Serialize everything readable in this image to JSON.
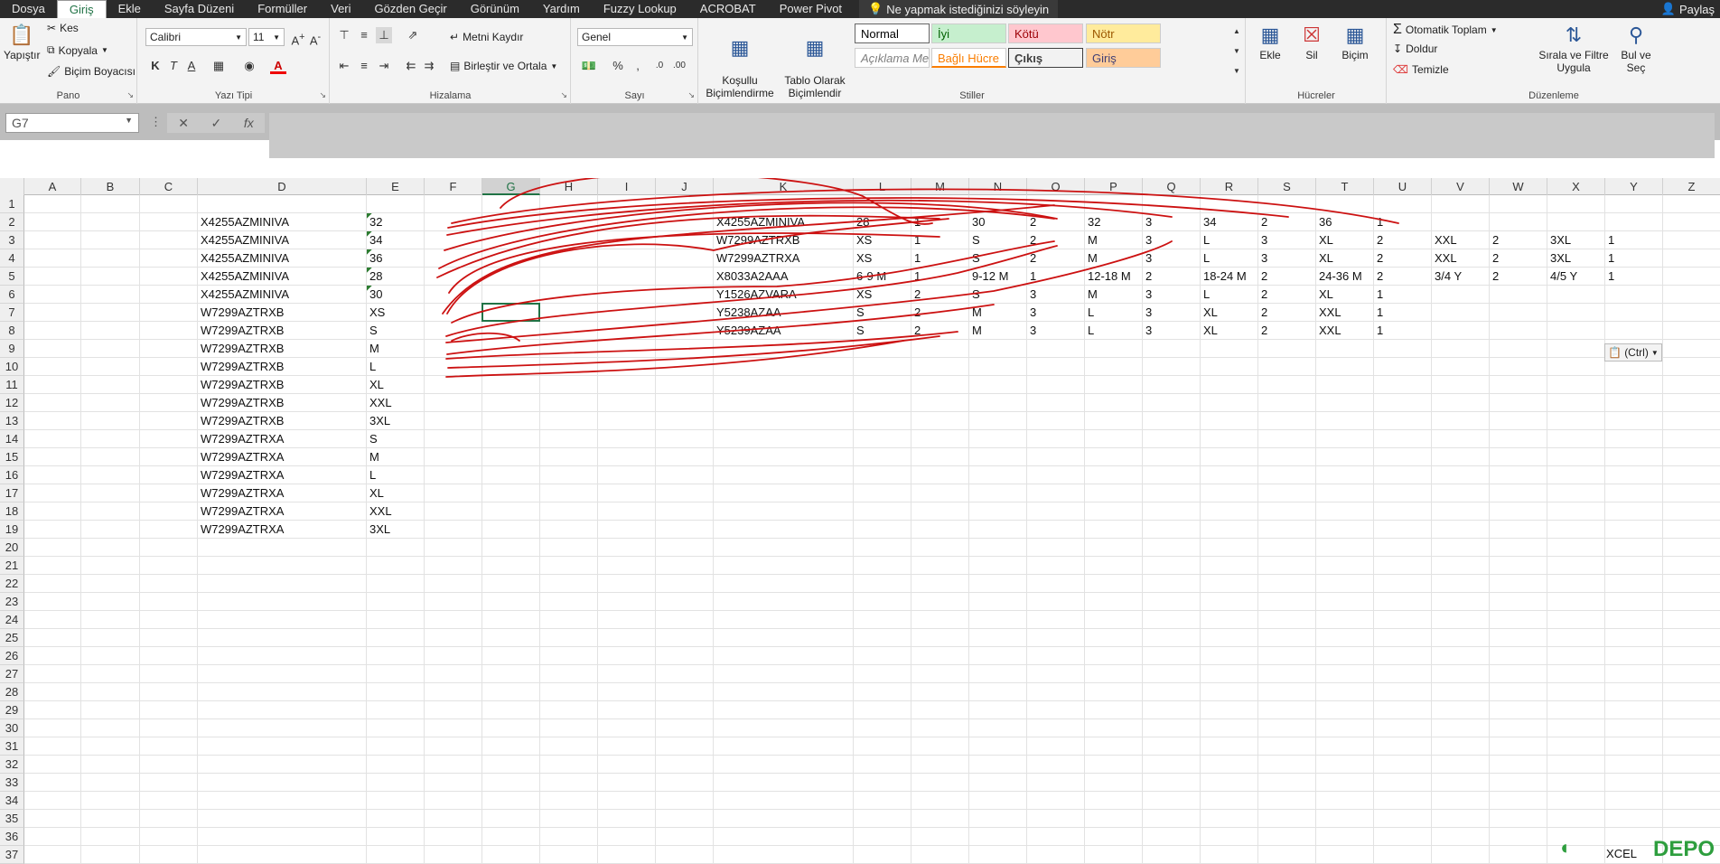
{
  "menu": {
    "tabs": [
      "Dosya",
      "Giriş",
      "Ekle",
      "Sayfa Düzeni",
      "Formüller",
      "Veri",
      "Gözden Geçir",
      "Görünüm",
      "Yardım",
      "Fuzzy Lookup",
      "ACROBAT",
      "Power Pivot"
    ],
    "active": "Giriş",
    "tell_me": "Ne yapmak istediğinizi söyleyin",
    "share": "Paylaş"
  },
  "ribbon": {
    "clipboard": {
      "paste": "Yapıştır",
      "cut": "Kes",
      "copy": "Kopyala",
      "painter": "Biçim Boyacısı",
      "label": "Pano"
    },
    "font": {
      "name": "Calibri",
      "size": "11",
      "bold": "K",
      "italic": "T",
      "underline": "A",
      "label": "Yazı Tipi"
    },
    "alignment": {
      "wrap": "Metni Kaydır",
      "merge": "Birleştir ve Ortala",
      "label": "Hizalama"
    },
    "number": {
      "format": "Genel",
      "label": "Sayı"
    },
    "styles": {
      "conditional": "Koşullu\nBiçimlendirme",
      "table": "Tablo Olarak\nBiçimlendir",
      "cells": [
        {
          "text": "Normal",
          "bg": "#ffffff",
          "color": "#000000"
        },
        {
          "text": "İyi",
          "bg": "#c6efce",
          "color": "#006100"
        },
        {
          "text": "Kötü",
          "bg": "#ffc7ce",
          "color": "#9c0006"
        },
        {
          "text": "Nötr",
          "bg": "#ffeb9c",
          "color": "#9c5700"
        },
        {
          "text": "Açıklama Me...",
          "bg": "#ffffff",
          "color": "#7f7f7f"
        },
        {
          "text": "Bağlı Hücre",
          "bg": "#ffffff",
          "color": "#fa7d00"
        },
        {
          "text": "Çıkış",
          "bg": "#f2f2f2",
          "color": "#3f3f3f"
        },
        {
          "text": "Giriş",
          "bg": "#ffcc99",
          "color": "#3f3f76"
        }
      ],
      "label": "Stiller"
    },
    "cells": {
      "insert": "Ekle",
      "delete": "Sil",
      "format": "Biçim",
      "label": "Hücreler"
    },
    "editing": {
      "autosum": "Otomatik Toplam",
      "fill": "Doldur",
      "clear": "Temizle",
      "sort": "Sırala ve Filtre\nUygula",
      "find": "Bul ve\nSeç",
      "label": "Düzenleme"
    }
  },
  "formula_bar": {
    "name_box": "G7",
    "formula": ""
  },
  "columns": [
    "A",
    "B",
    "C",
    "D",
    "E",
    "F",
    "G",
    "H",
    "I",
    "J",
    "K",
    "L",
    "M",
    "N",
    "O",
    "P",
    "Q",
    "R",
    "S",
    "T",
    "U",
    "V",
    "W",
    "X",
    "Y",
    "Z"
  ],
  "selected_column": "G",
  "rows": [
    "1",
    "2",
    "3",
    "4",
    "5",
    "6",
    "7",
    "8",
    "9",
    "10",
    "11",
    "12",
    "13",
    "14",
    "15",
    "16",
    "17",
    "18",
    "19",
    "20",
    "21",
    "22",
    "23",
    "24",
    "25",
    "26",
    "27",
    "28",
    "29",
    "30",
    "31",
    "32",
    "33",
    "34",
    "35",
    "36",
    "37"
  ],
  "cells": {
    "D": [
      "",
      "X4255AZMINIVA",
      "X4255AZMINIVA",
      "X4255AZMINIVA",
      "X4255AZMINIVA",
      "X4255AZMINIVA",
      "W7299AZTRXB",
      "W7299AZTRXB",
      "W7299AZTRXB",
      "W7299AZTRXB",
      "W7299AZTRXB",
      "W7299AZTRXB",
      "W7299AZTRXB",
      "W7299AZTRXA",
      "W7299AZTRXA",
      "W7299AZTRXA",
      "W7299AZTRXA",
      "W7299AZTRXA",
      "W7299AZTRXA"
    ],
    "E": [
      "",
      "32",
      "34",
      "36",
      "28",
      "30",
      "XS",
      "S",
      "M",
      "L",
      "XL",
      "XXL",
      "3XL",
      "S",
      "M",
      "L",
      "XL",
      "XXL",
      "3XL"
    ],
    "K": [
      "",
      "X4255AZMINIVA",
      "W7299AZTRXB",
      "W7299AZTRXA",
      "X8033A2AAA",
      "Y1526AZVARA",
      "Y5238AZAA",
      "Y5239AZAA"
    ],
    "L": [
      "",
      "28",
      "XS",
      "XS",
      "6-9 M",
      "XS",
      "S",
      "S"
    ],
    "M": [
      "",
      "1",
      "1",
      "1",
      "1",
      "2",
      "2",
      "2"
    ],
    "N": [
      "",
      "30",
      "S",
      "S",
      "9-12 M",
      "S",
      "M",
      "M"
    ],
    "O": [
      "",
      "2",
      "2",
      "2",
      "1",
      "3",
      "3",
      "3"
    ],
    "P": [
      "",
      "32",
      "M",
      "M",
      "12-18 M",
      "M",
      "L",
      "L"
    ],
    "Q": [
      "",
      "3",
      "3",
      "3",
      "2",
      "3",
      "3",
      "3"
    ],
    "R": [
      "",
      "34",
      "L",
      "L",
      "18-24 M",
      "L",
      "XL",
      "XL"
    ],
    "S": [
      "",
      "2",
      "3",
      "3",
      "2",
      "2",
      "2",
      "2"
    ],
    "T": [
      "",
      "36",
      "XL",
      "XL",
      "24-36 M",
      "XL",
      "XXL",
      "XXL"
    ],
    "U": [
      "",
      "1",
      "2",
      "2",
      "2",
      "1",
      "1",
      "1"
    ],
    "V": [
      "",
      "",
      "XXL",
      "XXL",
      "3/4 Y",
      "",
      "",
      ""
    ],
    "W": [
      "",
      "",
      "2",
      "2",
      "2",
      "",
      "",
      ""
    ],
    "X": [
      "",
      "",
      "3XL",
      "3XL",
      "4/5 Y",
      "",
      "",
      ""
    ],
    "Y": [
      "",
      "",
      "1",
      "1",
      "1",
      "",
      "",
      ""
    ]
  },
  "paste_options": "(Ctrl)",
  "watermark": {
    "brand": "DEPO",
    "small": "XCEL"
  },
  "colors": {
    "accent": "#217346",
    "ink": "#cc1111",
    "ribbon_bg": "#f3f3f3",
    "titlebar": "#2b2b2b"
  }
}
